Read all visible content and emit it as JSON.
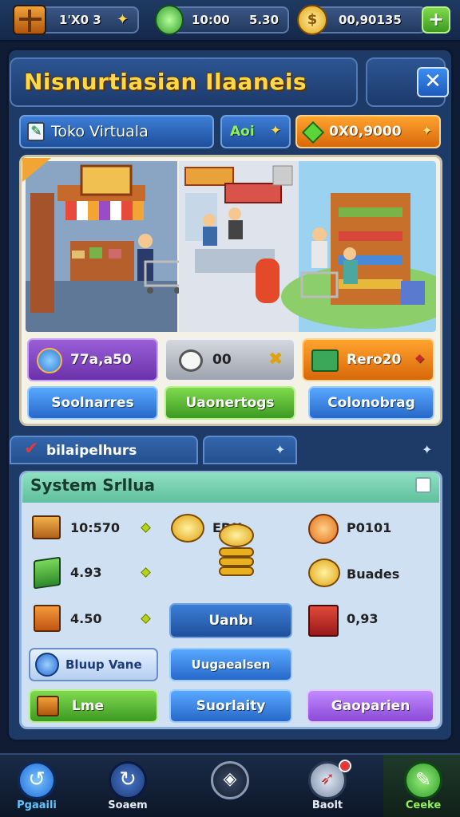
{
  "resources": {
    "crates": "1'X0 3",
    "gems": "10:00",
    "gems_secondary": "5.30",
    "coins": "00,90135"
  },
  "header": {
    "title": "Nisnurtiasian Ilaaneis",
    "close_glyph": "✕"
  },
  "store_row": {
    "store_name": "Toko Virtuala",
    "add_label": "Aoi",
    "funds": "0X0,9000"
  },
  "scene_stats": [
    {
      "value": "77a,a50"
    },
    {
      "value": "00"
    },
    {
      "value": "Rero20"
    }
  ],
  "scene_buttons": [
    "Soolnarres",
    "Uaonertogs",
    "Colonobrag"
  ],
  "system": {
    "tab_label": "bilaipelhurs",
    "header": "System Srllua",
    "rows": [
      {
        "value": "10:570"
      },
      {
        "value": "4.93"
      },
      {
        "value": "4.50"
      }
    ],
    "mid_label": "EDU",
    "right_rows": [
      {
        "value": "P0101"
      },
      {
        "value": "Buades"
      },
      {
        "value": "0,93"
      }
    ],
    "center_button": "Uanbı",
    "buttons_row1": [
      "Bluup Vane",
      "Uugaealsen"
    ],
    "buttons_row2": [
      "Lme",
      "Suorlaity",
      "Gaoparien"
    ]
  },
  "nav": [
    {
      "label": "Pgaaili",
      "icon": "refresh-icon"
    },
    {
      "label": "Soaem",
      "icon": "reload-icon"
    },
    {
      "label": "",
      "icon": "compass-icon"
    },
    {
      "label": "Baolt",
      "icon": "rocket-icon"
    },
    {
      "label": "Ceeke",
      "icon": "leaf-icon"
    }
  ]
}
